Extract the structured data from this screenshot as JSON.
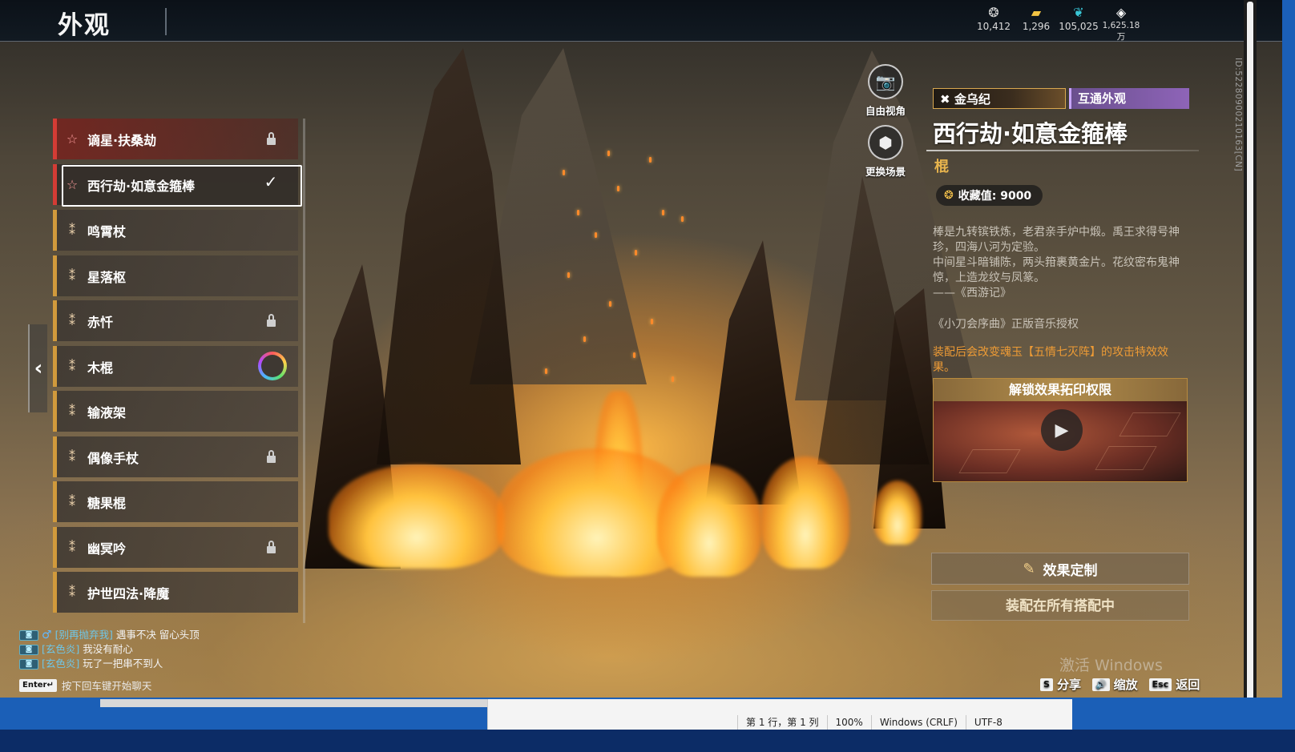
{
  "header": {
    "title": "外观"
  },
  "currencies": [
    {
      "icon": "silver-coin-icon",
      "glyph": "❂",
      "color": "#d8d8d8",
      "value": "10,412"
    },
    {
      "icon": "gold-ingot-icon",
      "glyph": "▰",
      "color": "#f3c443",
      "value": "1,296"
    },
    {
      "icon": "feather-icon",
      "glyph": "❦",
      "color": "#39c6d6",
      "value": "105,025"
    },
    {
      "icon": "diamond-icon",
      "glyph": "◈",
      "color": "#ffffff",
      "value": "1,625.18万"
    }
  ],
  "camera": {
    "free_view_label": "自由视角",
    "change_scene_label": "更换场景"
  },
  "items": [
    {
      "name": "谪星·扶桑劫",
      "style": "red",
      "mark": "☆",
      "status": "lock"
    },
    {
      "name": "西行劫·如意金箍棒",
      "style": "red",
      "mark": "☆",
      "status": "check",
      "selected": true
    },
    {
      "name": "鸣霄杖",
      "style": "gold",
      "mark": "⁑",
      "status": ""
    },
    {
      "name": "星落枢",
      "style": "gold",
      "mark": "⁑",
      "status": ""
    },
    {
      "name": "赤忏",
      "style": "gold",
      "mark": "⁑",
      "status": "lock"
    },
    {
      "name": "木棍",
      "style": "gold",
      "mark": "⁑",
      "status": "ring"
    },
    {
      "name": "输液架",
      "style": "gold",
      "mark": "⁑",
      "status": ""
    },
    {
      "name": "偶像手杖",
      "style": "gold",
      "mark": "⁑",
      "status": "lock"
    },
    {
      "name": "糖果棍",
      "style": "gold",
      "mark": "⁑",
      "status": ""
    },
    {
      "name": "幽冥吟",
      "style": "gold",
      "mark": "⁑",
      "status": "lock"
    },
    {
      "name": "护世四法·降魔",
      "style": "gold",
      "mark": "⁑",
      "status": ""
    }
  ],
  "detail": {
    "series_tag": "金乌纪",
    "share_tag": "互通外观",
    "title": "西行劫·如意金箍棒",
    "weapon_type": "棍",
    "collect_label": "收藏值: 9000",
    "desc_lines": [
      "棒是九转镔铁炼，老君亲手炉中煅。禹王求得号神",
      "珍，四海八河为定验。",
      "中间星斗暗铺陈，两头箝裹黄金片。花纹密布鬼神",
      "惊，上造龙纹与凤篆。",
      "——《西游记》"
    ],
    "license": "《小刀会序曲》正版音乐授权",
    "effect_note": "装配后会改变魂玉【五情七灭阵】的攻击特效效果。",
    "unlock_label": "解锁效果拓印权限",
    "custom_label": "效果定制",
    "equip_label": "装配在所有搭配中"
  },
  "side_id": "ID:5228090021016​3[CN]",
  "chat": [
    {
      "badge": "🎮",
      "gender": "♂",
      "name": "[别再抛弃我]",
      "msg": "遇事不决 留心头顶"
    },
    {
      "badge": "🎮",
      "gender": "",
      "name": "[玄色炎]",
      "msg": "我没有耐心"
    },
    {
      "badge": "🎮",
      "gender": "",
      "name": "[玄色炎]",
      "msg": "玩了一把串不到人"
    }
  ],
  "chat_hint": {
    "key": "Enter↵",
    "text": "按下回车键开始聊天"
  },
  "hints": [
    {
      "key": "S",
      "label": "分享"
    },
    {
      "key": "🔊",
      "label": "缩放"
    },
    {
      "key": "Esc",
      "label": "返回"
    }
  ],
  "watermark": "激活 Windows",
  "editor_status": [
    "第 1 行，第 1 列",
    "100%",
    "Windows (CRLF)",
    "UTF-8"
  ]
}
